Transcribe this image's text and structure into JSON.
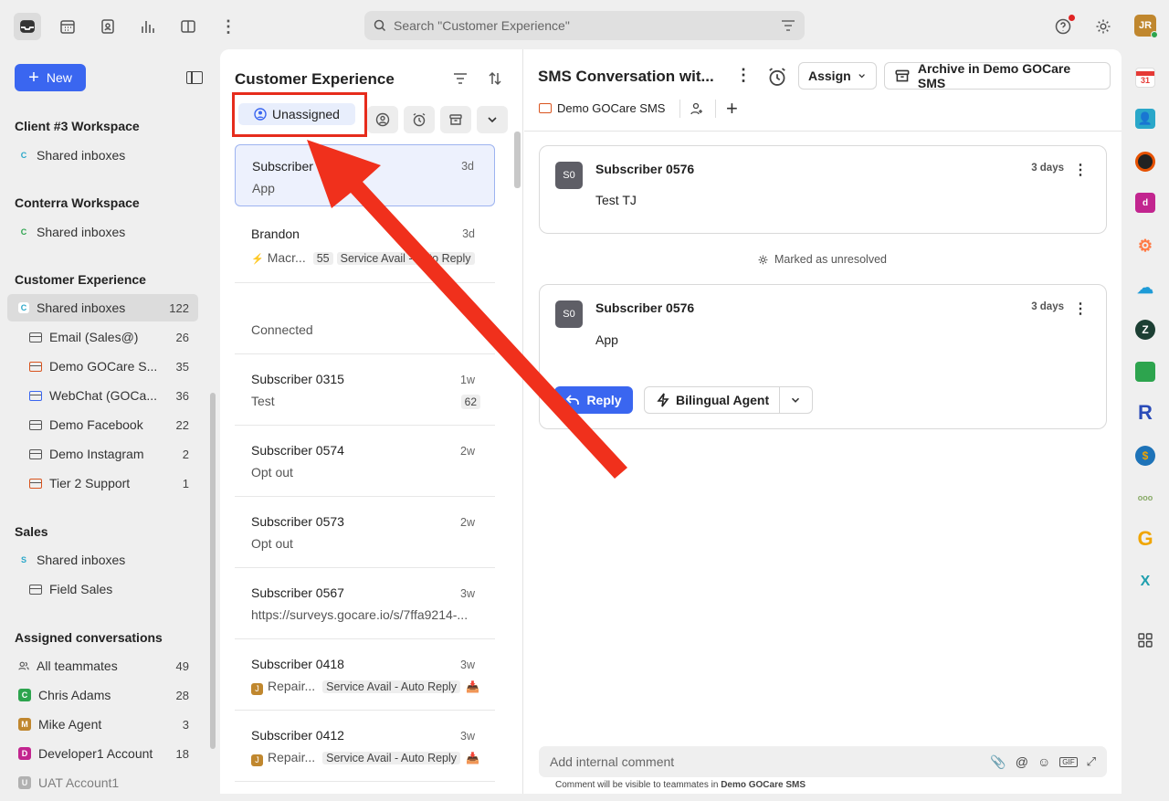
{
  "topbar": {
    "search_placeholder": "Search \"Customer Experience\"",
    "avatar_initials": "JR"
  },
  "sidebar": {
    "new_label": "New",
    "sections": [
      {
        "title": "Client #3 Workspace",
        "items": [
          {
            "label": "Shared inboxes",
            "badge": "C"
          }
        ]
      },
      {
        "title": "Conterra Workspace",
        "items": [
          {
            "label": "Shared inboxes",
            "badge": "C"
          }
        ]
      },
      {
        "title": "Customer Experience",
        "items": [
          {
            "label": "Shared inboxes",
            "badge": "C",
            "count": "122"
          },
          {
            "label": "Email (Sales@)",
            "count": "26"
          },
          {
            "label": "Demo GOCare S...",
            "count": "35"
          },
          {
            "label": "WebChat (GOCa...",
            "count": "36"
          },
          {
            "label": "Demo Facebook",
            "count": "22"
          },
          {
            "label": "Demo Instagram",
            "count": "2"
          },
          {
            "label": "Tier 2 Support",
            "count": "1"
          }
        ]
      },
      {
        "title": "Sales",
        "items": [
          {
            "label": "Shared inboxes",
            "badge": "S"
          },
          {
            "label": "Field Sales"
          }
        ]
      },
      {
        "title": "Assigned conversations",
        "items": [
          {
            "label": "All teammates",
            "count": "49"
          },
          {
            "label": "Chris Adams",
            "badge": "C",
            "count": "28"
          },
          {
            "label": "Mike Agent",
            "badge": "M",
            "count": "3"
          },
          {
            "label": "Developer1 Account",
            "badge": "D",
            "count": "18"
          },
          {
            "label": "UAT Account1",
            "badge": "U"
          }
        ]
      }
    ]
  },
  "list": {
    "title": "Customer Experience",
    "filter_active": "Unassigned",
    "conversations": [
      {
        "name": "Subscriber",
        "time": "3d",
        "preview": "App"
      },
      {
        "name": "Brandon",
        "time": "3d",
        "preview": "Macr...",
        "num": "55",
        "tag": "Service Avail - Auto Reply"
      },
      {
        "name": "",
        "time": "",
        "preview": "Connected"
      },
      {
        "name": "Subscriber 0315",
        "time": "1w",
        "preview": "Test",
        "num": "62"
      },
      {
        "name": "Subscriber 0574",
        "time": "2w",
        "preview": "Opt out"
      },
      {
        "name": "Subscriber 0573",
        "time": "2w",
        "preview": "Opt out"
      },
      {
        "name": "Subscriber 0567",
        "time": "3w",
        "preview": "https://surveys.gocare.io/s/7ffa9214-..."
      },
      {
        "name": "Subscriber 0418",
        "time": "3w",
        "preview": "Repair...",
        "tag": "Service Avail - Auto Reply",
        "badge": "J"
      },
      {
        "name": "Subscriber 0412",
        "time": "3w",
        "preview": "Repair...",
        "tag": "Service Avail - Auto Reply",
        "badge": "J"
      }
    ]
  },
  "conversation": {
    "title": "SMS Conversation wit...",
    "assign_label": "Assign",
    "archive_label": "Archive in Demo GOCare SMS",
    "inbox_label": "Demo GOCare SMS",
    "messages": [
      {
        "avatar": "S0",
        "author": "Subscriber 0576",
        "time": "3 days",
        "body": "Test TJ"
      },
      {
        "avatar": "S0",
        "author": "Subscriber 0576",
        "time": "3 days",
        "body": "App"
      }
    ],
    "status_note": "Marked as unresolved",
    "reply_label": "Reply",
    "agent_label": "Bilingual Agent",
    "comment_placeholder": "Add internal comment",
    "comment_note_prefix": "Comment will be visible to teammates in ",
    "comment_note_inbox": "Demo GOCare SMS"
  },
  "rail": {
    "calendar_day": "31",
    "r_letter": "R",
    "g_letter": "G",
    "x_letter": "X"
  },
  "colors": {
    "accent": "#3a66f0",
    "highlight": "#e62c1c"
  }
}
